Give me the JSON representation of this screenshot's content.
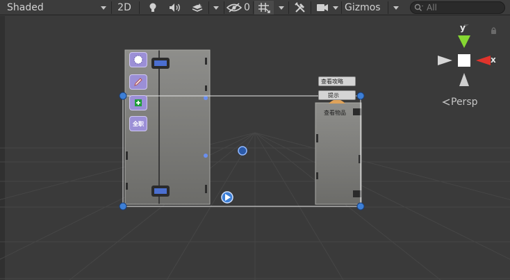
{
  "toolbar": {
    "shading_mode": "Shaded",
    "mode_2d": "2D",
    "hidden_objects_count": "0",
    "gizmos_label": "Gizmos",
    "search_placeholder": "All",
    "icons": [
      "lighting-icon",
      "audio-icon",
      "effects-icon",
      "visibility-icon",
      "grid-snapping-icon",
      "tools-icon",
      "camera-icon",
      "search-icon"
    ]
  },
  "scene": {
    "left_panel_icons": [
      "circle-icon",
      "pen-icon",
      "plus-icon"
    ],
    "left_panel_tile_text": "全职",
    "right_panel": {
      "button_1": "查看攻略",
      "button_2": "提示",
      "label": "查看物品"
    },
    "gizmo": {
      "y_label": "y",
      "x_label": "x",
      "projection": "Persp"
    },
    "colors": {
      "background": "#3a3a3a",
      "panel": "#7d7d7a",
      "handle": "#3d7fd6",
      "x_axis": "#e0342c",
      "y_axis": "#7ed321",
      "tile": "#9b8fd6"
    }
  }
}
